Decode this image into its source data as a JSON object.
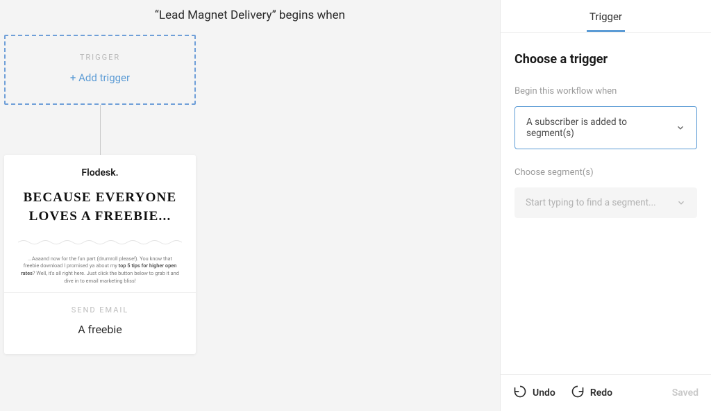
{
  "canvas": {
    "workflow_title": "“Lead Magnet Delivery” begins when",
    "trigger_block": {
      "label": "TRIGGER",
      "add_link": "+ Add trigger"
    },
    "email_card": {
      "preview_logo": "Flodesk.",
      "preview_headline": "BECAUSE EVERYONE LOVES A FREEBIE...",
      "preview_body_1": "...Aaaand now for the fun part (drumroll please!). You know that freebie download I promised ya about my ",
      "preview_body_bold": "top 5 tips for higher open rates",
      "preview_body_2": "? Well, it's all right here. Just click the button below to grab it and dive in to email marketing bliss!",
      "send_label": "SEND EMAIL",
      "email_name": "A freebie"
    }
  },
  "panel": {
    "tab_label": "Trigger",
    "heading": "Choose a trigger",
    "field1_label": "Begin this workflow when",
    "trigger_select_value": "A subscriber is added to segment(s)",
    "field2_label": "Choose segment(s)",
    "segment_placeholder": "Start typing to find a segment..."
  },
  "footer": {
    "undo": "Undo",
    "redo": "Redo",
    "saved": "Saved"
  }
}
